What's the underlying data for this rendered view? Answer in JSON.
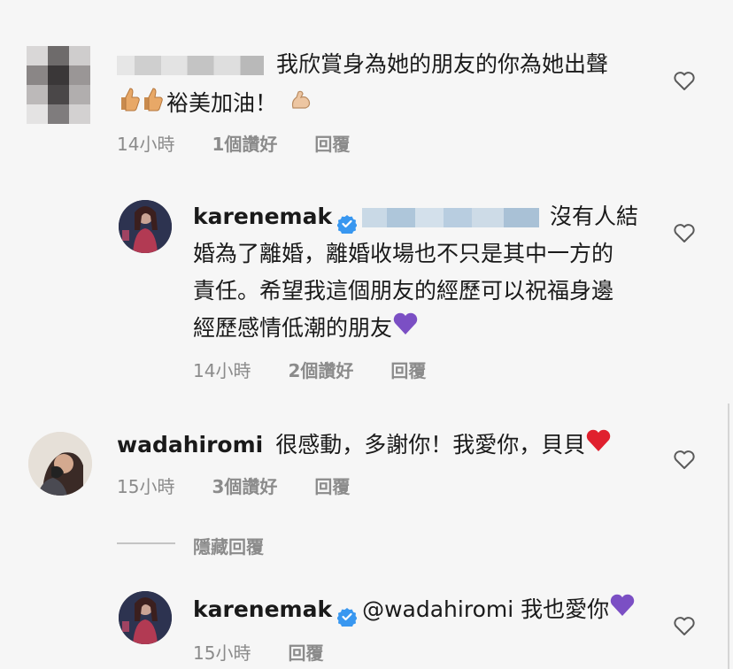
{
  "comments": [
    {
      "line1": "我欣賞身為她的朋友的你為她出聲",
      "line2": "裕美加油！",
      "time": "14小時",
      "likes": "1個讚好",
      "reply": "回覆"
    },
    {
      "username": "karenemak",
      "line1": "沒有人結",
      "line2": "婚為了離婚，離婚收場也不只是其中一方的",
      "line3": "責任。希望我這個朋友的經歷可以祝福身邊",
      "line4": "經歷感情低潮的朋友",
      "time": "14小時",
      "likes": "2個讚好",
      "reply": "回覆"
    },
    {
      "username": "wadahiromi",
      "text": "很感動，多謝你！我愛你，貝貝",
      "time": "15小時",
      "likes": "3個讚好",
      "reply": "回覆"
    },
    {
      "username": "karenemak",
      "text": "@wadahiromi 我也愛你",
      "time": "15小時",
      "reply": "回覆"
    }
  ],
  "hide_replies": "隱藏回覆",
  "icons": {
    "like": "heart-outline-icon",
    "verified": "verified-badge-icon"
  },
  "colors": {
    "meta_text": "#8b8b8b",
    "verified_blue": "#3897f0",
    "purple_heart": "#7b4fc4",
    "red_heart": "#e0202e"
  }
}
